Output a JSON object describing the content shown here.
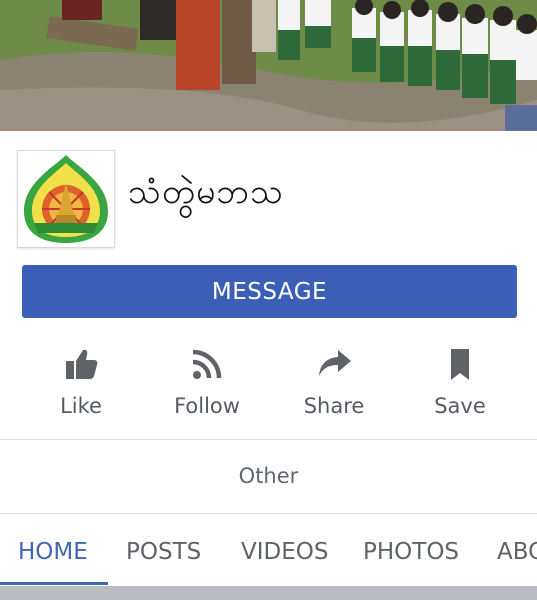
{
  "header": {
    "page_name": "သံတွဲမဘသ"
  },
  "primary_action": {
    "label": "MESSAGE"
  },
  "actions": [
    {
      "label": "Like",
      "icon": "thumbs-up-icon"
    },
    {
      "label": "Follow",
      "icon": "rss-icon"
    },
    {
      "label": "Share",
      "icon": "share-arrow-icon"
    },
    {
      "label": "Save",
      "icon": "bookmark-icon"
    }
  ],
  "other": {
    "label": "Other"
  },
  "tabs": [
    {
      "label": "HOME",
      "active": true
    },
    {
      "label": "POSTS",
      "active": false
    },
    {
      "label": "VIDEOS",
      "active": false
    },
    {
      "label": "PHOTOS",
      "active": false
    },
    {
      "label": "ABOUT",
      "active": false
    }
  ],
  "colors": {
    "accent": "#4267b2",
    "message_button": "#3b5eb7",
    "icon_gray": "#5f6368"
  }
}
